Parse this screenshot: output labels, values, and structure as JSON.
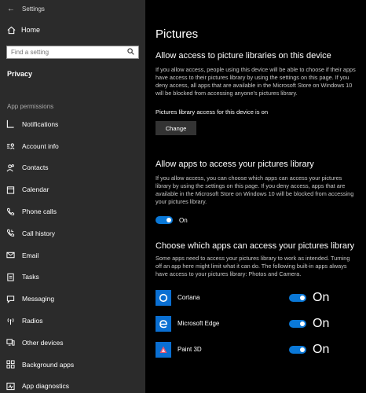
{
  "window": {
    "title": "Settings"
  },
  "sidebar": {
    "home_label": "Home",
    "search_placeholder": "Find a setting",
    "section_title": "Privacy",
    "group_label": "App permissions",
    "items": [
      {
        "label": "Notifications",
        "icon": "notifications-icon"
      },
      {
        "label": "Account info",
        "icon": "account-info-icon"
      },
      {
        "label": "Contacts",
        "icon": "contacts-icon"
      },
      {
        "label": "Calendar",
        "icon": "calendar-icon"
      },
      {
        "label": "Phone calls",
        "icon": "phone-icon"
      },
      {
        "label": "Call history",
        "icon": "call-history-icon"
      },
      {
        "label": "Email",
        "icon": "email-icon"
      },
      {
        "label": "Tasks",
        "icon": "tasks-icon"
      },
      {
        "label": "Messaging",
        "icon": "messaging-icon"
      },
      {
        "label": "Radios",
        "icon": "radios-icon"
      },
      {
        "label": "Other devices",
        "icon": "other-devices-icon"
      },
      {
        "label": "Background apps",
        "icon": "background-apps-icon"
      },
      {
        "label": "App diagnostics",
        "icon": "app-diagnostics-icon"
      }
    ]
  },
  "main": {
    "title": "Pictures",
    "section1": {
      "heading": "Allow access to picture libraries on this device",
      "description": "If you allow access, people using this device will be able to choose if their apps have access to their pictures library by using the settings on this page. If you deny access, all apps that are available in the Microsoft Store on Windows 10 will be blocked from accessing anyone’s pictures library.",
      "status": "Pictures library access for this device is on",
      "button_label": "Change"
    },
    "section2": {
      "heading": "Allow apps to access your pictures library",
      "description": "If you allow access, you can choose which apps can access your pictures library by using the settings on this page. If you deny access, apps that are available in the Microsoft Store on Windows 10 will be blocked from accessing your pictures library.",
      "toggle_state": "On"
    },
    "section3": {
      "heading": "Choose which apps can access your pictures library",
      "description": "Some apps need to access your pictures library to work as intended. Turning off an app here might limit what it can do. The following built-in apps always have access to your pictures library: Photos and Camera.",
      "apps": [
        {
          "name": "Cortana",
          "toggle_state": "On",
          "icon": "cortana-icon"
        },
        {
          "name": "Microsoft Edge",
          "toggle_state": "On",
          "icon": "edge-icon"
        },
        {
          "name": "Paint 3D",
          "toggle_state": "On",
          "icon": "paint3d-icon"
        }
      ]
    }
  },
  "colors": {
    "accent": "#0a78d7",
    "sidebar_bg": "#2b2b2b",
    "main_bg": "#000000",
    "app_tile": "#0a6fd2"
  }
}
